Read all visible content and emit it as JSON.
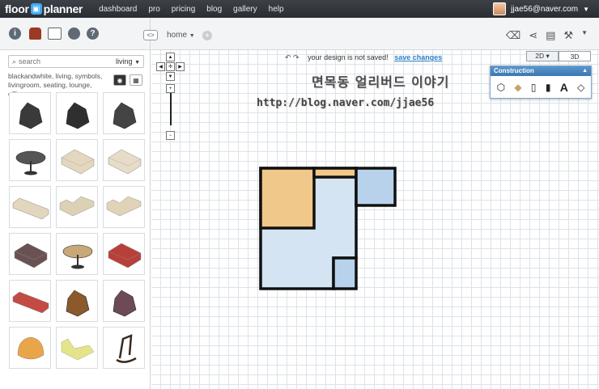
{
  "app": {
    "logo_left": "floor",
    "logo_badge": "▣",
    "logo_right": "planner"
  },
  "nav": [
    "dashboard",
    "pro",
    "pricing",
    "blog",
    "gallery",
    "help"
  ],
  "user": {
    "email": "jjae56@naver.com"
  },
  "toolbar": {
    "icons": [
      "info-icon",
      "item-icon",
      "photo-icon",
      "bomb-icon",
      "help-icon"
    ],
    "tab_label": "home",
    "right_icons": [
      "eraser-icon",
      "share-icon",
      "print-icon",
      "wrench-icon"
    ]
  },
  "library": {
    "search_placeholder": "search",
    "category": "living",
    "tags": "blackandwhite, living, symbols, livingroom, seating, lounge, office,",
    "items": [
      {
        "name": "lounge-chair-black",
        "color": "#3a3a3a"
      },
      {
        "name": "eames-chair",
        "color": "#2f2f2f"
      },
      {
        "name": "armchair-dark",
        "color": "#444444"
      },
      {
        "name": "round-table",
        "color": "#555555"
      },
      {
        "name": "sofa-beige",
        "color": "#e3d7bf"
      },
      {
        "name": "sofa-cream",
        "color": "#e6dcc7"
      },
      {
        "name": "sofa-long-beige",
        "color": "#e2d6bd"
      },
      {
        "name": "corner-sofa",
        "color": "#dcd0b5"
      },
      {
        "name": "corner-sofa-2",
        "color": "#e0d3b8"
      },
      {
        "name": "sofa-brown",
        "color": "#6b5252"
      },
      {
        "name": "coffee-table",
        "color": "#c8a878"
      },
      {
        "name": "sofa-red",
        "color": "#b8403a"
      },
      {
        "name": "daybed-red",
        "color": "#c44a44"
      },
      {
        "name": "armchair-wood",
        "color": "#8a5a2a"
      },
      {
        "name": "armchair-plum",
        "color": "#6e4a54"
      },
      {
        "name": "tub-chair-orange",
        "color": "#e8a54a"
      },
      {
        "name": "chaise-yellow",
        "color": "#e4e48a"
      },
      {
        "name": "rocking-chair",
        "color": "#3a2a1e"
      }
    ]
  },
  "canvas": {
    "status_text": "your design is not saved!",
    "save_link": "save changes",
    "mode_2d": "2D ▾",
    "mode_3d": "3D",
    "watermark_korean": "면목동 얼리버드 이야기",
    "watermark_url": "http://blog.naver.com/jjae56"
  },
  "construction": {
    "title": "Construction",
    "tools": [
      "wall-tool-icon",
      "floor-tool-icon",
      "door-tool-icon",
      "window-tool-icon",
      "text-tool-icon",
      "dimension-tool-icon"
    ]
  },
  "colors": {
    "room_orange": "#f0c88a",
    "room_blue": "#d4e4f2",
    "room_blue_small": "#b8d2ec",
    "wall": "#111111"
  }
}
